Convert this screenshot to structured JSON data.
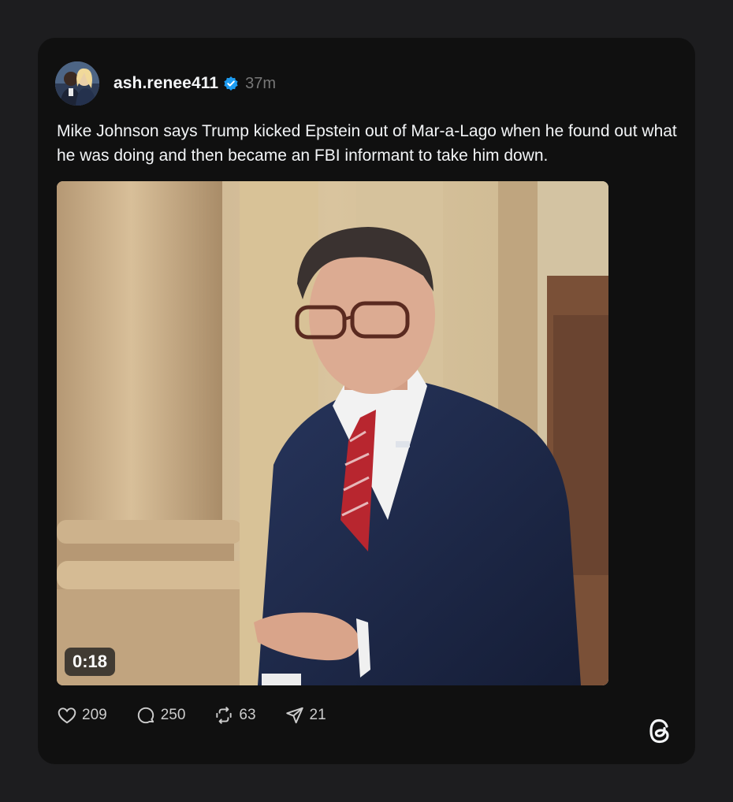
{
  "post": {
    "username": "ash.renee411",
    "timestamp": "37m",
    "text": "Mike Johnson says Trump kicked Epstein out of Mar-a-Lago when he found out what he was doing and then became an FBI informant to take him down.",
    "video_duration": "0:18"
  },
  "actions": {
    "likes": "209",
    "replies": "250",
    "reposts": "63",
    "shares": "21"
  },
  "colors": {
    "background": "#1d1d1f",
    "card": "#101010",
    "text": "#f3f5f7",
    "muted": "#777777",
    "verified": "#1d9bf0"
  },
  "icons": {
    "verified": "verified-badge-icon",
    "like": "heart-icon",
    "reply": "comment-icon",
    "repost": "repost-icon",
    "share": "send-icon",
    "brand": "threads-logo-icon"
  }
}
